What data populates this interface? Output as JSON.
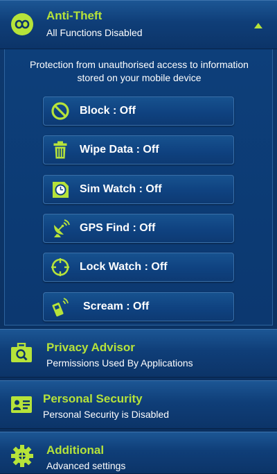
{
  "anti_theft": {
    "title": "Anti-Theft",
    "subtitle": "All Functions Disabled",
    "description_line1": "Protection from unauthorised access to information",
    "description_line2": "stored on your mobile device",
    "buttons": [
      {
        "label": "Block : Off",
        "icon": "block-icon"
      },
      {
        "label": "Wipe Data : Off",
        "icon": "trash-icon"
      },
      {
        "label": "Sim Watch : Off",
        "icon": "sim-watch-icon"
      },
      {
        "label": "GPS Find : Off",
        "icon": "satellite-dish-icon"
      },
      {
        "label": "Lock Watch : Off",
        "icon": "crosshair-icon"
      },
      {
        "label": "Scream : Off",
        "icon": "ringing-phone-icon"
      }
    ]
  },
  "privacy_advisor": {
    "title": "Privacy Advisor",
    "subtitle": "Permissions Used By Applications"
  },
  "personal_security": {
    "title": "Personal Security",
    "subtitle": "Personal Security is Disabled"
  },
  "additional": {
    "title": "Additional",
    "subtitle": "Advanced settings"
  },
  "colors": {
    "accent": "#b6e33a",
    "background": "#0d3f7a",
    "text": "#ffffff"
  }
}
